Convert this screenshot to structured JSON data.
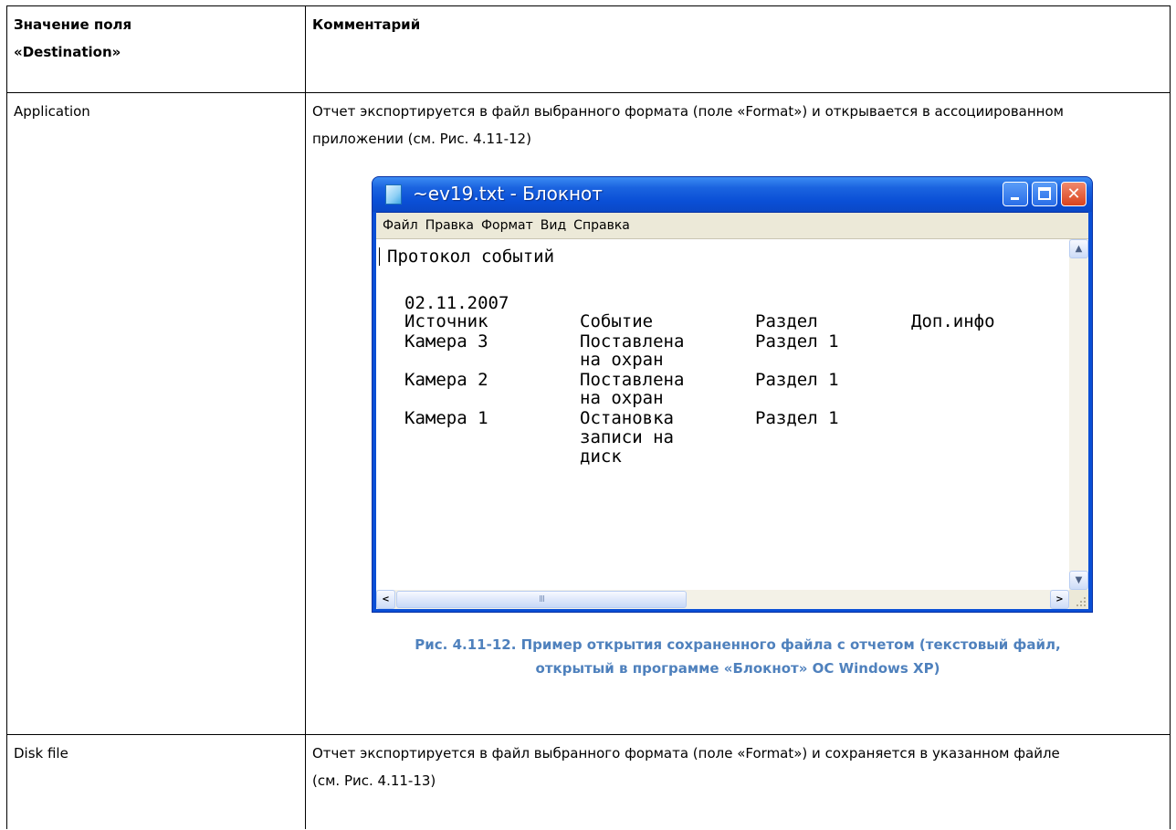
{
  "table": {
    "header": {
      "col1_line1": "Значение поля",
      "col1_line2": "«Destination»",
      "col2": "Комментарий"
    },
    "rows": [
      {
        "value": "Application",
        "comment": "Отчет экспортируется в файл выбранного формата (поле «Format») и открывается в ассоциированном приложении (см. Рис. 4.11-12)"
      },
      {
        "value": "Disk file",
        "comment": "Отчет экспортируется в файл выбранного формата (поле «Format») и сохраняется в указанном файле (см. Рис. 4.11-13)"
      }
    ]
  },
  "notepad": {
    "title": "~ev19.txt - Блокнот",
    "menu": [
      "Файл",
      "Правка",
      "Формат",
      "Вид",
      "Справка"
    ],
    "content": {
      "title_line": "Протокол событий",
      "date": "02.11.2007",
      "headers": {
        "source": "Источник",
        "event": "Событие",
        "section": "Раздел",
        "info": "Доп.инфо"
      },
      "records": [
        {
          "source": "Камера 3",
          "event_lines": [
            "Поставлена",
            "на охран"
          ],
          "section": "Раздел 1"
        },
        {
          "source": "Камера 2",
          "event_lines": [
            "Поставлена",
            "на охран"
          ],
          "section": "Раздел 1"
        },
        {
          "source": "Камера 1",
          "event_lines": [
            "Остановка",
            "записи на",
            "диск"
          ],
          "section": "Раздел 1"
        }
      ]
    },
    "icons": {
      "app": "notepad-icon",
      "minimize": "minimize-icon",
      "maximize": "maximize-icon",
      "close": "close-icon"
    },
    "close_glyph": "✕",
    "scroll_glyphs": {
      "up": "▲",
      "down": "▼",
      "left": "<",
      "right": ">",
      "thumb_grip": "III"
    }
  },
  "figure": {
    "caption_line1": "Рис. 4.11-12. Пример открытия сохраненного файла с отчетом (текстовый файл,",
    "caption_line2": "открытый в программе «Блокнот» ОС Windows XP)"
  }
}
